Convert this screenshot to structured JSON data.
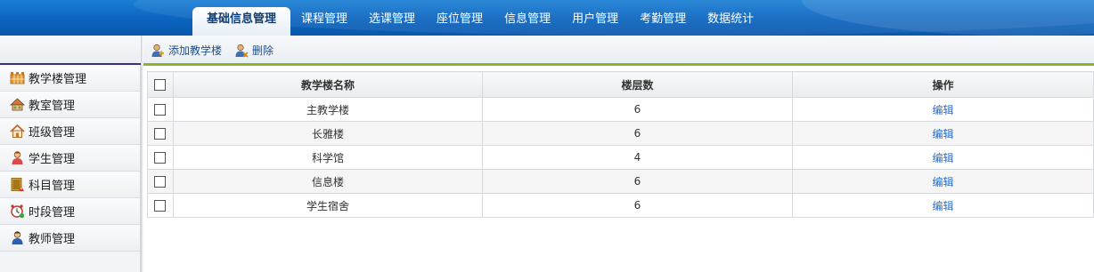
{
  "nav": {
    "tabs": [
      {
        "label": "基础信息管理",
        "active": true
      },
      {
        "label": "课程管理"
      },
      {
        "label": "选课管理"
      },
      {
        "label": "座位管理"
      },
      {
        "label": "信息管理"
      },
      {
        "label": "用户管理"
      },
      {
        "label": "考勤管理"
      },
      {
        "label": "数据统计"
      }
    ]
  },
  "toolbar": {
    "add_label": "添加教学楼",
    "delete_label": "删除"
  },
  "sidebar": {
    "items": [
      {
        "label": "教学楼管理",
        "icon": "building-icon"
      },
      {
        "label": "教室管理",
        "icon": "classroom-icon"
      },
      {
        "label": "班级管理",
        "icon": "house-icon"
      },
      {
        "label": "学生管理",
        "icon": "student-icon"
      },
      {
        "label": "科目管理",
        "icon": "book-icon"
      },
      {
        "label": "时段管理",
        "icon": "clock-icon"
      },
      {
        "label": "教师管理",
        "icon": "teacher-icon"
      }
    ]
  },
  "table": {
    "headers": {
      "name": "教学楼名称",
      "floors": "楼层数",
      "action": "操作"
    },
    "rows": [
      {
        "name": "主教学楼",
        "floors": "6",
        "action": "编辑"
      },
      {
        "name": "长雅楼",
        "floors": "6",
        "action": "编辑"
      },
      {
        "name": "科学馆",
        "floors": "4",
        "action": "编辑"
      },
      {
        "name": "信息楼",
        "floors": "6",
        "action": "编辑"
      },
      {
        "name": "学生宿舍",
        "floors": "6",
        "action": "编辑"
      }
    ]
  },
  "colors": {
    "nav_blue": "#0b63bf",
    "accent_green": "#86b82a",
    "link_blue": "#2a6dc8"
  }
}
